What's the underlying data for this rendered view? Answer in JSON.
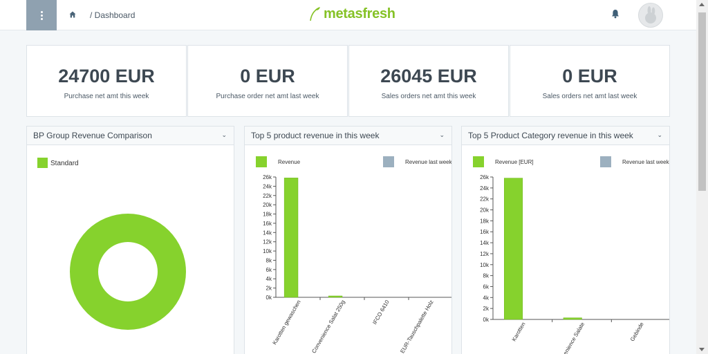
{
  "header": {
    "breadcrumb": "/ Dashboard",
    "logo_text": "metasfresh",
    "icons": [
      "menu-icon",
      "home-icon",
      "bell-icon",
      "avatar-icon"
    ]
  },
  "colors": {
    "accent": "#85c226",
    "series_primary": "#86d22d",
    "series_secondary": "#9cb0bf",
    "menu_bg": "#8fa1b0"
  },
  "kpis": [
    {
      "value": "24700 EUR",
      "caption": "Purchase net amt this week"
    },
    {
      "value": "0 EUR",
      "caption": "Purchase order net amt last week"
    },
    {
      "value": "26045 EUR",
      "caption": "Sales orders net amt this week"
    },
    {
      "value": "0 EUR",
      "caption": "Sales orders net amt last week"
    }
  ],
  "panels": [
    {
      "title": "BP Group Revenue Comparison"
    },
    {
      "title": "Top 5 product revenue in this week"
    },
    {
      "title": "Top 5 Product Category revenue in this week"
    }
  ],
  "chart_data": [
    {
      "type": "pie",
      "variant": "donut",
      "legend": [
        "Standard"
      ],
      "slices": [
        {
          "label": "Standard",
          "value": 100
        }
      ],
      "colors": [
        "#86d22d"
      ]
    },
    {
      "type": "bar",
      "categories": [
        "Karotten gewaschen",
        "Convenience Salat 250g",
        "IFCO 6410",
        "EUR-Tauschpalette Holz"
      ],
      "series": [
        {
          "name": "Revenue",
          "values": [
            25800,
            300,
            0,
            0
          ]
        },
        {
          "name": "Revenue last week",
          "values": [
            0,
            0,
            0,
            0
          ]
        }
      ],
      "ylim": [
        0,
        26000
      ],
      "yticks": [
        "0k",
        "2k",
        "4k",
        "6k",
        "8k",
        "10k",
        "12k",
        "14k",
        "16k",
        "18k",
        "20k",
        "22k",
        "24k",
        "26k"
      ],
      "colors": [
        "#86d22d",
        "#9cb0bf"
      ]
    },
    {
      "type": "bar",
      "categories": [
        "Karotten",
        "Convenience Salate",
        "Gebinde"
      ],
      "series": [
        {
          "name": "Revenue [EUR]",
          "values": [
            25800,
            300,
            0
          ]
        },
        {
          "name": "Revenue last week",
          "values": [
            0,
            0,
            0
          ]
        }
      ],
      "ylim": [
        0,
        26000
      ],
      "yticks": [
        "0k",
        "2k",
        "4k",
        "6k",
        "8k",
        "10k",
        "12k",
        "14k",
        "16k",
        "18k",
        "20k",
        "22k",
        "24k",
        "26k"
      ],
      "colors": [
        "#86d22d",
        "#9cb0bf"
      ]
    }
  ]
}
